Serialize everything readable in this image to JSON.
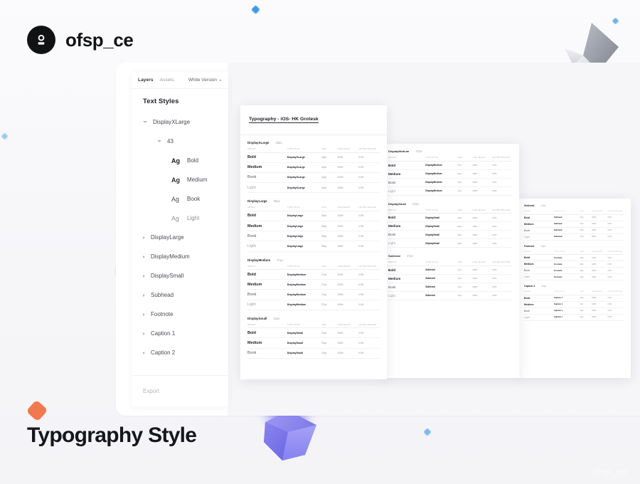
{
  "brand": {
    "name": "ofsp_ce",
    "mark_icon": "user-avatar-icon"
  },
  "page_heading": "Typography Style",
  "watermark": "ofsp_ce",
  "panel": {
    "tabs": [
      {
        "label": "Layers",
        "active": true
      },
      {
        "label": "Assets",
        "active": false
      }
    ],
    "version_selector": {
      "label": "White Version",
      "icon": "chevron-down-icon"
    },
    "title": "Text Styles",
    "footer_action": "Export",
    "tree": [
      {
        "label": "DisplayXLarge",
        "level": 1,
        "expanded": true
      },
      {
        "label": "43",
        "level": 2,
        "expanded": true
      },
      {
        "label": "Bold",
        "level": 3,
        "glyph": "Ag",
        "weight": "bold"
      },
      {
        "label": "Medium",
        "level": 3,
        "glyph": "Ag",
        "weight": "med"
      },
      {
        "label": "Book",
        "level": 3,
        "glyph": "Ag",
        "weight": "book"
      },
      {
        "label": "Light",
        "level": 3,
        "glyph": "Ag",
        "weight": "light"
      },
      {
        "label": "DisplayLarge",
        "level": 1,
        "expanded": false
      },
      {
        "label": "DisplayMedium",
        "level": 1,
        "expanded": false
      },
      {
        "label": "DisplaySmall",
        "level": 1,
        "expanded": false
      },
      {
        "label": "Subhead",
        "level": 1,
        "expanded": false
      },
      {
        "label": "Footnote",
        "level": 1,
        "expanded": false
      },
      {
        "label": "Caption 1",
        "level": 1,
        "expanded": false
      },
      {
        "label": "Caption 2",
        "level": 1,
        "expanded": false
      }
    ]
  },
  "documents": [
    {
      "id": "card-front",
      "title": "Typography - iOS- HK Grotesk",
      "columns": [
        "WEIGHT",
        "TYPE STYLE",
        "SIZE",
        "LINE HEIGHT",
        "LETTER SPACING"
      ],
      "sections": [
        {
          "name": "DisplayXLarge",
          "size": "43px",
          "rows": [
            {
              "weight": "Bold",
              "style": "DisplayXLarge",
              "size": "43px",
              "line": "100%",
              "tracking": "0.0%"
            },
            {
              "weight": "Medium",
              "style": "DisplayXLarge",
              "size": "43px",
              "line": "100%",
              "tracking": "0.0%"
            },
            {
              "weight": "Book",
              "style": "DisplayXLarge",
              "size": "43px",
              "line": "100%",
              "tracking": "0.0%"
            },
            {
              "weight": "Light",
              "style": "DisplayXLarge",
              "size": "43px",
              "line": "100%",
              "tracking": "0.0%"
            }
          ]
        },
        {
          "name": "DisplayLarge",
          "size": "35px",
          "rows": [
            {
              "weight": "Bold",
              "style": "DisplayLarge",
              "size": "35px",
              "line": "100%",
              "tracking": "0.0%"
            },
            {
              "weight": "Medium",
              "style": "DisplayLarge",
              "size": "35px",
              "line": "100%",
              "tracking": "0.0%"
            },
            {
              "weight": "Book",
              "style": "DisplayLarge",
              "size": "35px",
              "line": "100%",
              "tracking": "0.0%"
            },
            {
              "weight": "Light",
              "style": "DisplayLarge",
              "size": "35px",
              "line": "100%",
              "tracking": "0.0%"
            }
          ]
        },
        {
          "name": "DisplayMedium",
          "size": "27px",
          "rows": [
            {
              "weight": "Bold",
              "style": "DisplayMedium",
              "size": "27px",
              "line": "100%",
              "tracking": "0.0%"
            },
            {
              "weight": "Medium",
              "style": "DisplayMedium",
              "size": "27px",
              "line": "100%",
              "tracking": "0.0%"
            },
            {
              "weight": "Book",
              "style": "DisplayMedium",
              "size": "27px",
              "line": "100%",
              "tracking": "0.0%"
            },
            {
              "weight": "Light",
              "style": "DisplayMedium",
              "size": "27px",
              "line": "100%",
              "tracking": "0.0%"
            }
          ]
        },
        {
          "name": "DisplaySmall",
          "size": "22px",
          "rows": [
            {
              "weight": "Bold",
              "style": "DisplaySmall",
              "size": "22px",
              "line": "100%",
              "tracking": "0.0%"
            },
            {
              "weight": "Medium",
              "style": "DisplaySmall",
              "size": "22px",
              "line": "100%",
              "tracking": "0.0%"
            },
            {
              "weight": "Book",
              "style": "DisplaySmall",
              "size": "22px",
              "line": "100%",
              "tracking": "0.0%"
            }
          ]
        }
      ]
    },
    {
      "id": "card-middle",
      "columns": [
        "WEIGHT",
        "TYPE STYLE",
        "SIZE",
        "LINE HEIGHT",
        "LETTER SPACING"
      ],
      "sections": [
        {
          "name": "DisplayMedium",
          "size": "27px",
          "rows": [
            {
              "weight": "Bold",
              "style": "DisplayMedium",
              "size": "27px",
              "line": "100%",
              "tracking": "0.0%"
            },
            {
              "weight": "Medium",
              "style": "DisplayMedium",
              "size": "27px",
              "line": "100%",
              "tracking": "0.0%"
            },
            {
              "weight": "Book",
              "style": "DisplayMedium",
              "size": "27px",
              "line": "100%",
              "tracking": "0.0%"
            },
            {
              "weight": "Light",
              "style": "DisplayMedium",
              "size": "27px",
              "line": "100%",
              "tracking": "0.0%"
            }
          ]
        },
        {
          "name": "DisplaySmall",
          "size": "22px",
          "rows": [
            {
              "weight": "Bold",
              "style": "DisplaySmall",
              "size": "22px",
              "line": "100%",
              "tracking": "0.0%"
            },
            {
              "weight": "Medium",
              "style": "DisplaySmall",
              "size": "22px",
              "line": "100%",
              "tracking": "0.0%"
            },
            {
              "weight": "Book",
              "style": "DisplaySmall",
              "size": "22px",
              "line": "100%",
              "tracking": "0.0%"
            },
            {
              "weight": "Light",
              "style": "DisplaySmall",
              "size": "22px",
              "line": "100%",
              "tracking": "0.0%"
            }
          ]
        },
        {
          "name": "Subhead",
          "size": "17px",
          "rows": [
            {
              "weight": "Bold",
              "style": "Subhead",
              "size": "17px",
              "line": "100%",
              "tracking": "0.0%"
            },
            {
              "weight": "Medium",
              "style": "Subhead",
              "size": "17px",
              "line": "100%",
              "tracking": "0.0%"
            },
            {
              "weight": "Book",
              "style": "Subhead",
              "size": "17px",
              "line": "100%",
              "tracking": "0.0%"
            },
            {
              "weight": "Light",
              "style": "Subhead",
              "size": "17px",
              "line": "100%",
              "tracking": "0.0%"
            }
          ]
        }
      ]
    },
    {
      "id": "card-back",
      "columns": [
        "WEIGHT",
        "TYPE STYLE",
        "SIZE",
        "LINE HEIGHT",
        "LETTER SPACING"
      ],
      "sections": [
        {
          "name": "Subhead",
          "size": "17px",
          "rows": [
            {
              "weight": "Bold",
              "style": "Subhead",
              "size": "17px",
              "line": "100%",
              "tracking": "0.0%"
            },
            {
              "weight": "Medium",
              "style": "Subhead",
              "size": "17px",
              "line": "100%",
              "tracking": "0.0%"
            },
            {
              "weight": "Book",
              "style": "Subhead",
              "size": "17px",
              "line": "100%",
              "tracking": "0.0%"
            },
            {
              "weight": "Light",
              "style": "Subhead",
              "size": "17px",
              "line": "100%",
              "tracking": "0.0%"
            }
          ]
        },
        {
          "name": "Footnote",
          "size": "13px",
          "rows": [
            {
              "weight": "Bold",
              "style": "Footnote",
              "size": "13px",
              "line": "100%",
              "tracking": "0.0%"
            },
            {
              "weight": "Medium",
              "style": "Footnote",
              "size": "13px",
              "line": "100%",
              "tracking": "0.0%"
            },
            {
              "weight": "Book",
              "style": "Footnote",
              "size": "13px",
              "line": "100%",
              "tracking": "0.0%"
            },
            {
              "weight": "Light",
              "style": "Footnote",
              "size": "13px",
              "line": "100%",
              "tracking": "0.0%"
            }
          ]
        },
        {
          "name": "Caption 1",
          "size": "11px",
          "rows": [
            {
              "weight": "Bold",
              "style": "Caption 1",
              "size": "11px",
              "line": "100%",
              "tracking": "0.0%"
            },
            {
              "weight": "Medium",
              "style": "Caption 1",
              "size": "11px",
              "line": "100%",
              "tracking": "0.0%"
            },
            {
              "weight": "Book",
              "style": "Caption 1",
              "size": "11px",
              "line": "100%",
              "tracking": "0.0%"
            },
            {
              "weight": "Light",
              "style": "Caption 1",
              "size": "11px",
              "line": "100%",
              "tracking": "0.0%"
            }
          ]
        }
      ]
    }
  ],
  "colors": {
    "background": "#f6f6f9",
    "ink": "#15171c",
    "accent_purple": "#7b76ee",
    "accent_blue": "#3d9ae8",
    "accent_orange": "#f2794f",
    "accent_yellow": "#f6d33c",
    "grey_shape": "#9fa3ad"
  }
}
